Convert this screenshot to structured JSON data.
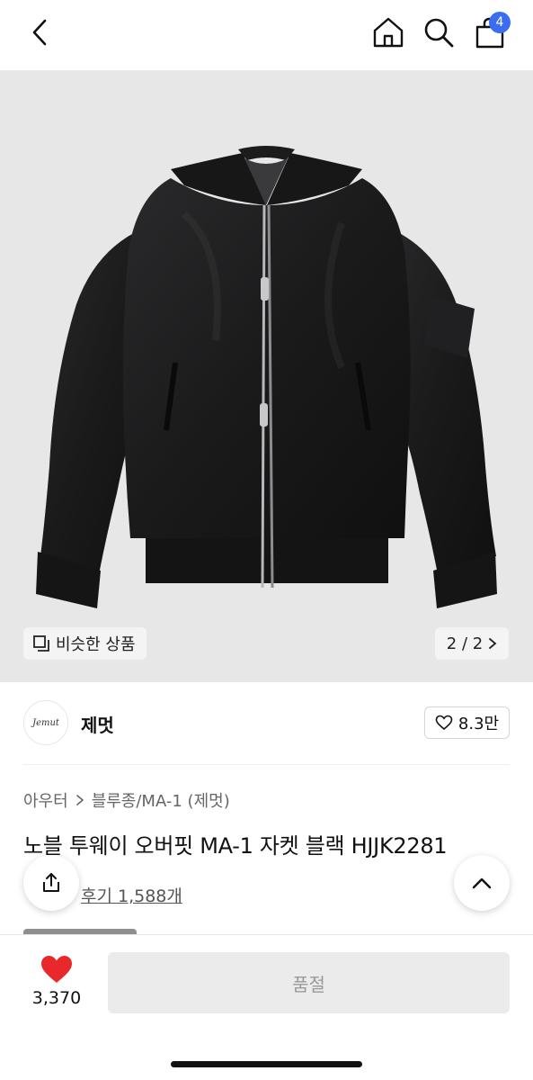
{
  "header": {
    "cart_count": "4"
  },
  "gallery": {
    "similar_label": "비슷한 상품",
    "pager_text": "2 / 2"
  },
  "brand": {
    "logo_text": "Jemut",
    "name": "제멋",
    "like_count": "8.3만"
  },
  "product": {
    "breadcrumb_category": "아우터",
    "breadcrumb_sub": "블루종/MA-1 (제멋)",
    "title": "노블 투웨이 오버핏 MA-1 자켓 블랙 HJJK2281",
    "review_text": "후기 1,588개"
  },
  "bottom": {
    "wish_count": "3,370",
    "soldout_label": "품절"
  },
  "colors": {
    "accent": "#3a6df0",
    "heart": "#e8282b"
  }
}
